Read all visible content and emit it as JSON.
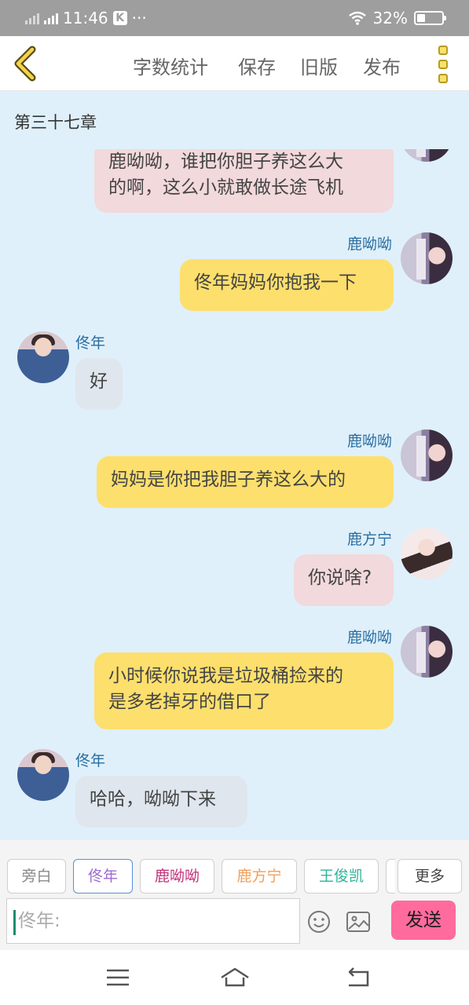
{
  "status_bar": {
    "time": "11:46",
    "k_badge": "K",
    "more_dots": "···",
    "battery_percent": "32%",
    "battery_level": 0.32
  },
  "toolbar": {
    "word_count": "字数统计",
    "save": "保存",
    "old_version": "旧版",
    "publish": "发布"
  },
  "chapter_title": "第三十七章",
  "messages": [
    {
      "speaker": "",
      "side": "right",
      "style": "pink",
      "text": "鹿呦呦，谁把你胆子养这么大\n的啊，这么小就敢做长途飞机"
    },
    {
      "speaker": "鹿呦呦",
      "side": "right",
      "style": "yellow",
      "text": "佟年妈妈你抱我一下"
    },
    {
      "speaker": "佟年",
      "side": "left",
      "style": "grey",
      "text": "好"
    },
    {
      "speaker": "鹿呦呦",
      "side": "right",
      "style": "yellow",
      "text": "妈妈是你把我胆子养这么大的"
    },
    {
      "speaker": "鹿方宁",
      "side": "right",
      "style": "pink",
      "text": "你说啥?"
    },
    {
      "speaker": "鹿呦呦",
      "side": "right",
      "style": "yellow",
      "text": "小时候你说我是垃圾桶捡来的\n是多老掉牙的借口了"
    },
    {
      "speaker": "佟年",
      "side": "left",
      "style": "grey",
      "text": "哈哈，呦呦下来"
    }
  ],
  "character_tabs": [
    {
      "label": "旁白",
      "color": "#888888"
    },
    {
      "label": "佟年",
      "color": "#9b6bd1",
      "active": true
    },
    {
      "label": "鹿呦呦",
      "color": "#c2307a"
    },
    {
      "label": "鹿方宁",
      "color": "#f0a05a"
    },
    {
      "label": "王俊凯",
      "color": "#2fb39a"
    }
  ],
  "more_label": "更多",
  "input": {
    "placeholder": "佟年:"
  },
  "send_label": "发送",
  "icons": {
    "emoji": "emoji-icon",
    "image": "image-icon",
    "back": "chevron-left-icon",
    "menu": "more-vertical-icon"
  }
}
